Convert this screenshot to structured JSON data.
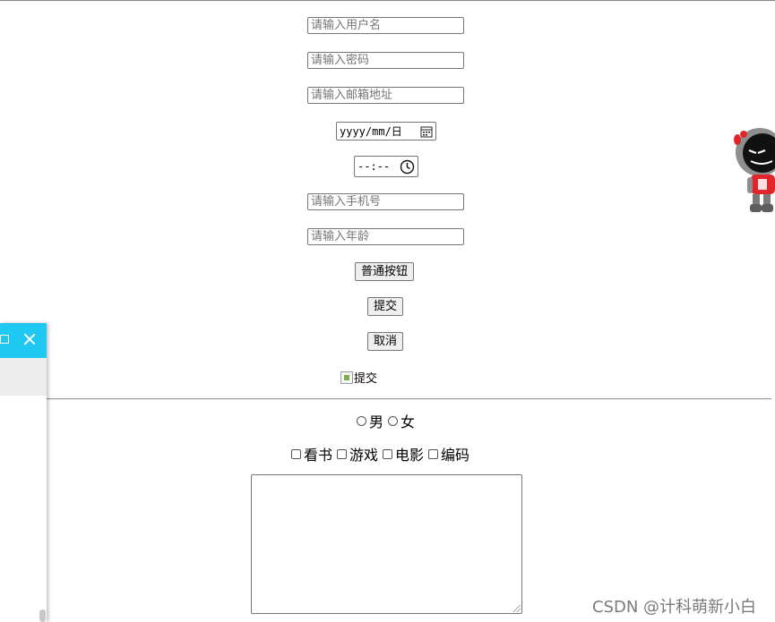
{
  "form": {
    "username_placeholder": "请输入用户名",
    "password_placeholder": "请输入密码",
    "email_placeholder": "请输入邮箱地址",
    "date_value": "yyyy/mm/日",
    "time_value": "--:--",
    "phone_placeholder": "请输入手机号",
    "age_placeholder": "请输入年龄",
    "normal_button": "普通按钮",
    "submit_button": "提交",
    "cancel_button": "取消",
    "image_alt": "提交"
  },
  "gender": [
    "男",
    "女"
  ],
  "hobbies": [
    "看书",
    "游戏",
    "电影",
    "编码"
  ],
  "watermark": "CSDN @计科萌新小白",
  "colors": {
    "panel_bar": "#1ec8f0",
    "mascot_red": "#e0262a"
  }
}
